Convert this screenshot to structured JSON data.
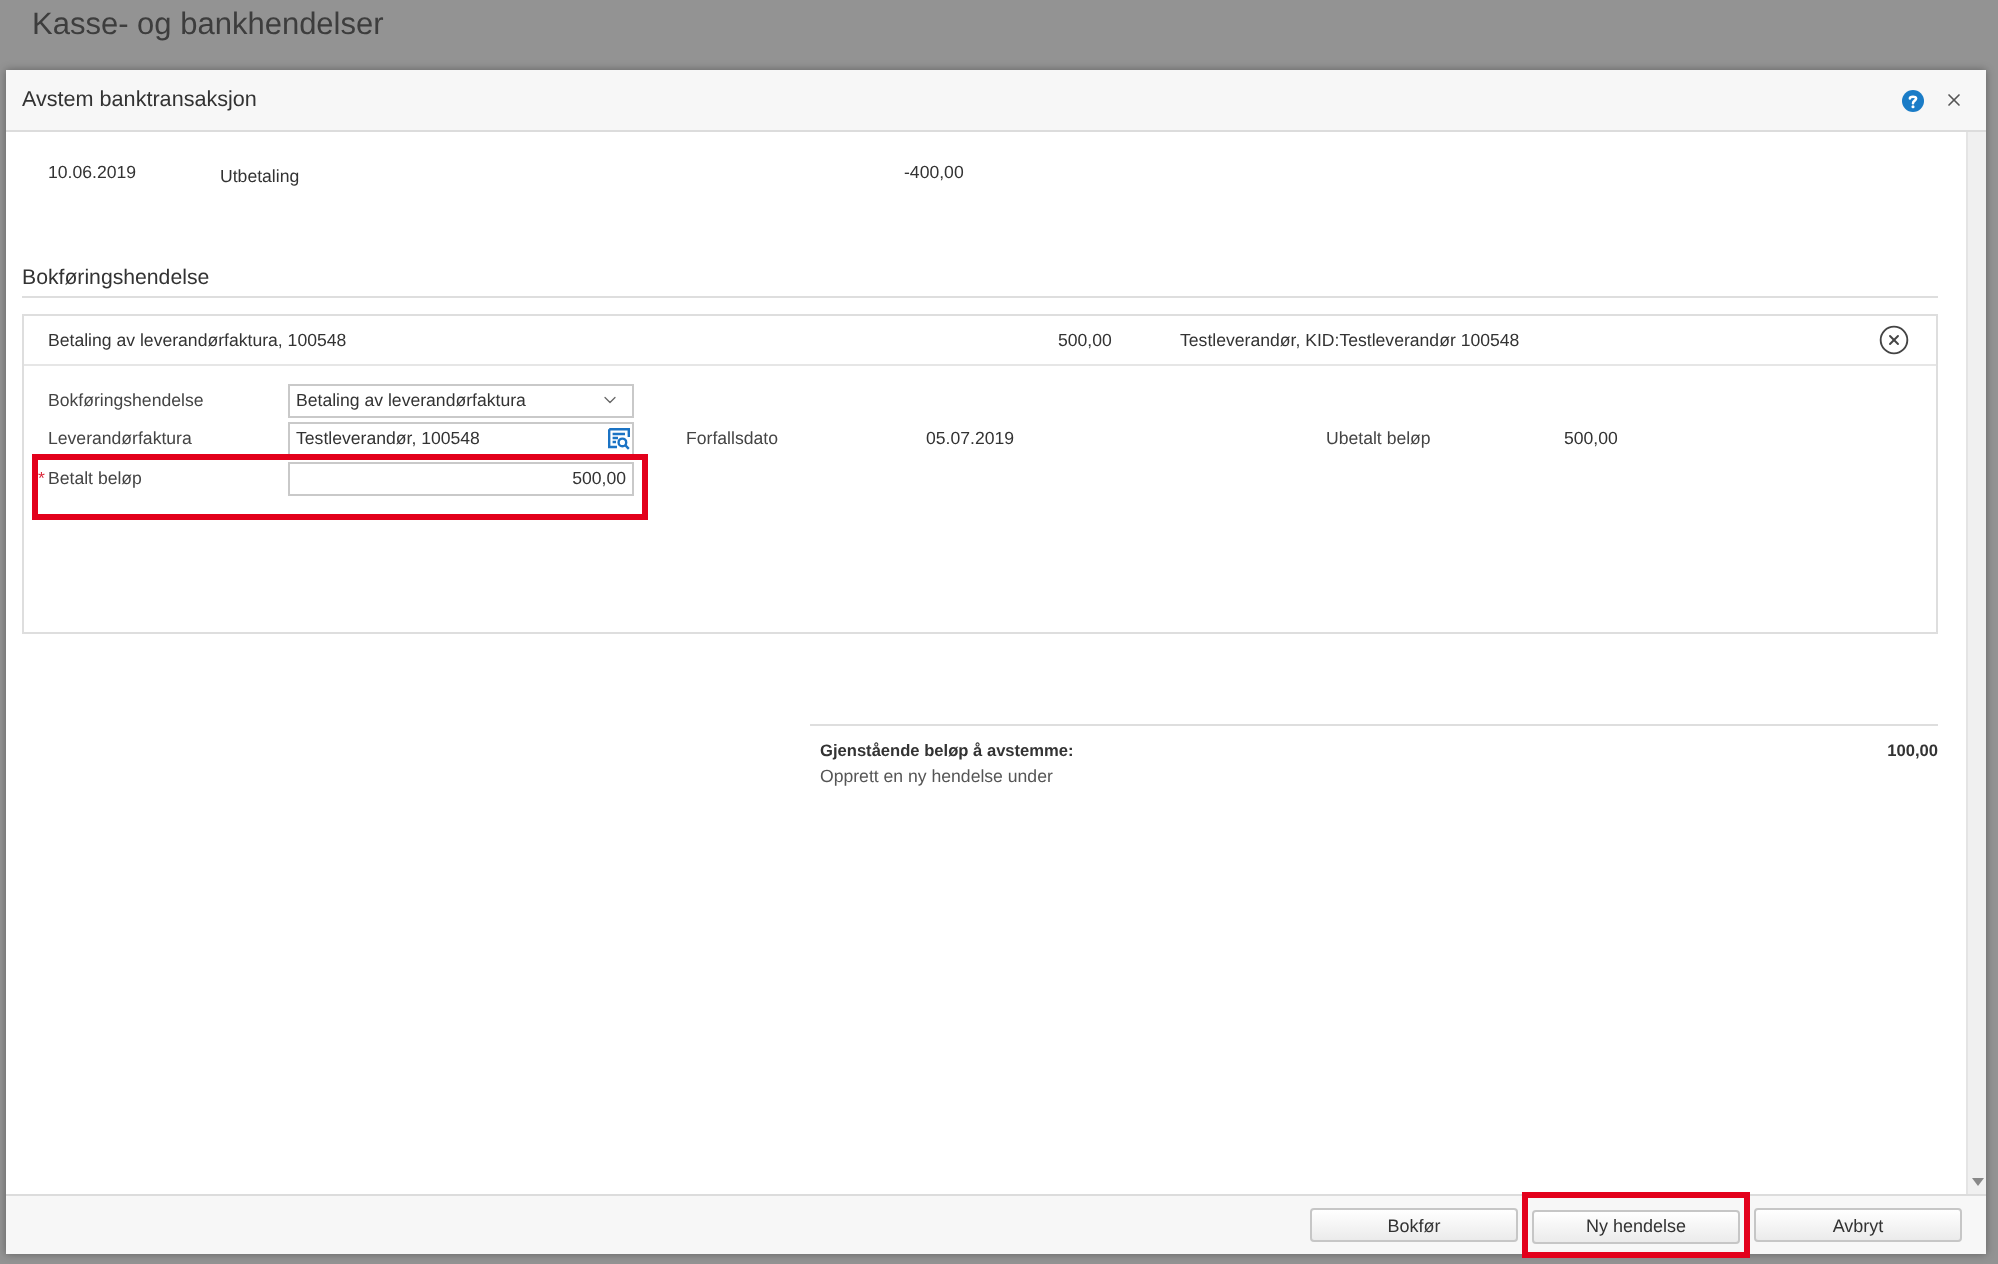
{
  "page": {
    "title": "Kasse- og bankhendelser"
  },
  "dialog": {
    "title": "Avstem banktransaksjon"
  },
  "transaction": {
    "date": "10.06.2019",
    "type": "Utbetaling",
    "amount": "-400,00"
  },
  "posting": {
    "heading": "Bokføringshendelse",
    "entry": {
      "summary": "Betaling av leverandørfaktura, 100548",
      "amount": "500,00",
      "counterparty": "Testleverandør, KID:Testleverandør 100548"
    },
    "fields": [
      {
        "kind": "select",
        "label": "Bokføringshendelse",
        "value": "Betaling av leverandørfaktura",
        "highlighted": false
      },
      {
        "kind": "lookup",
        "label": "Leverandørfaktura",
        "value": "Testleverandør, 100548",
        "highlighted": false,
        "extras": [
          {
            "label": "Forfallsdato",
            "value": "05.07.2019"
          },
          {
            "label": "Ubetalt beløp",
            "value": "500,00"
          }
        ]
      },
      {
        "kind": "amount",
        "label": "Betalt beløp",
        "required_mark": "*",
        "value": "500,00",
        "highlighted": true
      }
    ]
  },
  "remaining": {
    "label": "Gjenstående beløp å avstemme:",
    "amount": "100,00",
    "hint": "Opprett en ny hendelse under"
  },
  "buttons": [
    {
      "label": "Bokfør",
      "highlighted": false
    },
    {
      "label": "Ny hendelse",
      "highlighted": true
    },
    {
      "label": "Avbryt",
      "highlighted": false
    }
  ]
}
